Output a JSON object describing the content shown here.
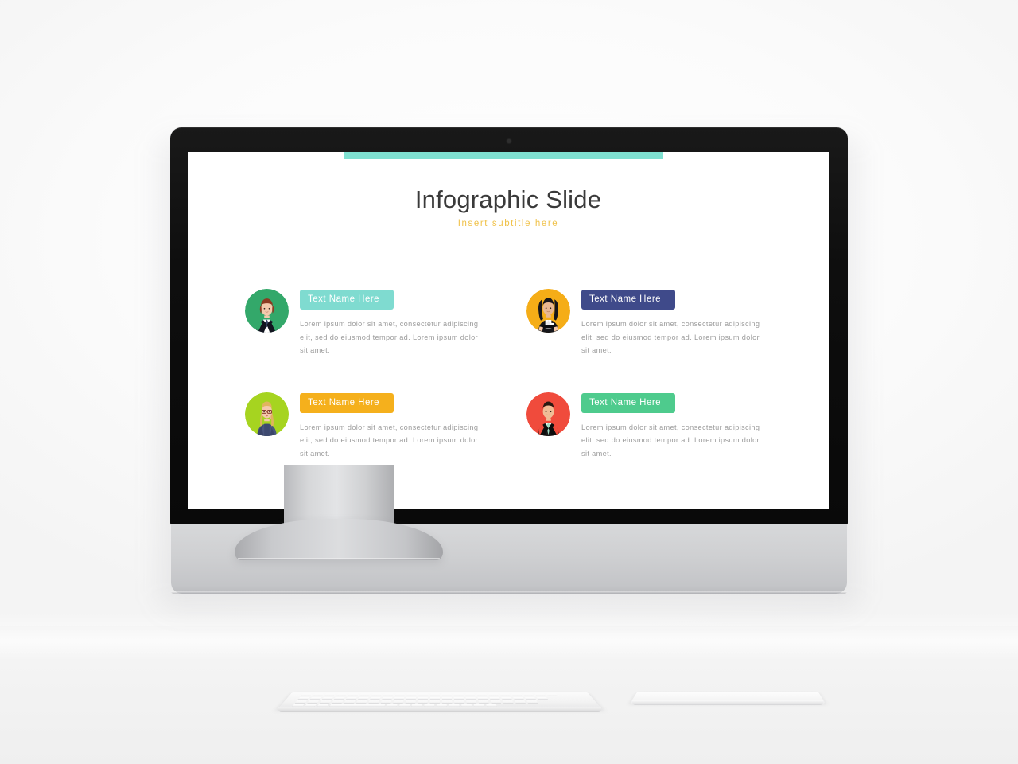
{
  "scene": {
    "device": "desktop-computer-monitor",
    "peripherals": [
      "keyboard",
      "trackpad"
    ]
  },
  "slide": {
    "title": "Infographic Slide",
    "subtitle": "Insert  subtitle  here",
    "accent_bar_color": "#7fe0d0",
    "background_color": "#ffffff",
    "title_color": "#3a3a3a",
    "subtitle_color": "#f0c24a",
    "body_text_color": "#9d9d9d",
    "items": [
      {
        "name_label": "Text Name Here",
        "body": "Lorem ipsum dolor sit amet, consectetur adipiscing elit, sed do eiusmod tempor ad. Lorem ipsum dolor sit amet.",
        "tag_color": "#7fdbd0",
        "avatar_icon": "businesswoman-avatar-icon",
        "avatar_bg": "#33a86a",
        "hair_color": "#8c3b22",
        "suit_color": "#2a2f45",
        "shirt_color": "#ffffff"
      },
      {
        "name_label": "Text Name Here",
        "body": "Lorem ipsum dolor sit amet, consectetur adipiscing elit, sed do eiusmod tempor ad. Lorem ipsum dolor sit amet.",
        "tag_color": "#3f4a8a",
        "avatar_icon": "businesswoman-arms-crossed-avatar-icon",
        "avatar_bg": "#f5ad17",
        "hair_color": "#17161a",
        "suit_color": "#16161a",
        "shirt_color": "#ffffff"
      },
      {
        "name_label": "Text Name Here",
        "body": "Lorem ipsum dolor sit amet, consectetur adipiscing elit, sed do eiusmod tempor ad. Lorem ipsum dolor sit amet.",
        "tag_color": "#f5b01c",
        "avatar_icon": "businesswoman-glasses-avatar-icon",
        "avatar_bg": "#a6d420",
        "hair_color": "#e0b45e",
        "suit_color": "#49557d",
        "shirt_color": "#49557d"
      },
      {
        "name_label": "Text Name Here",
        "body": "Lorem ipsum dolor sit amet, consectetur adipiscing elit, sed do eiusmod tempor ad. Lorem ipsum dolor sit amet.",
        "tag_color": "#4ecb8d",
        "avatar_icon": "businessman-avatar-icon",
        "avatar_bg": "#f04b3c",
        "hair_color": "#2a1a12",
        "suit_color": "#1a1a1a",
        "shirt_color": "#9fdcc4"
      }
    ]
  }
}
